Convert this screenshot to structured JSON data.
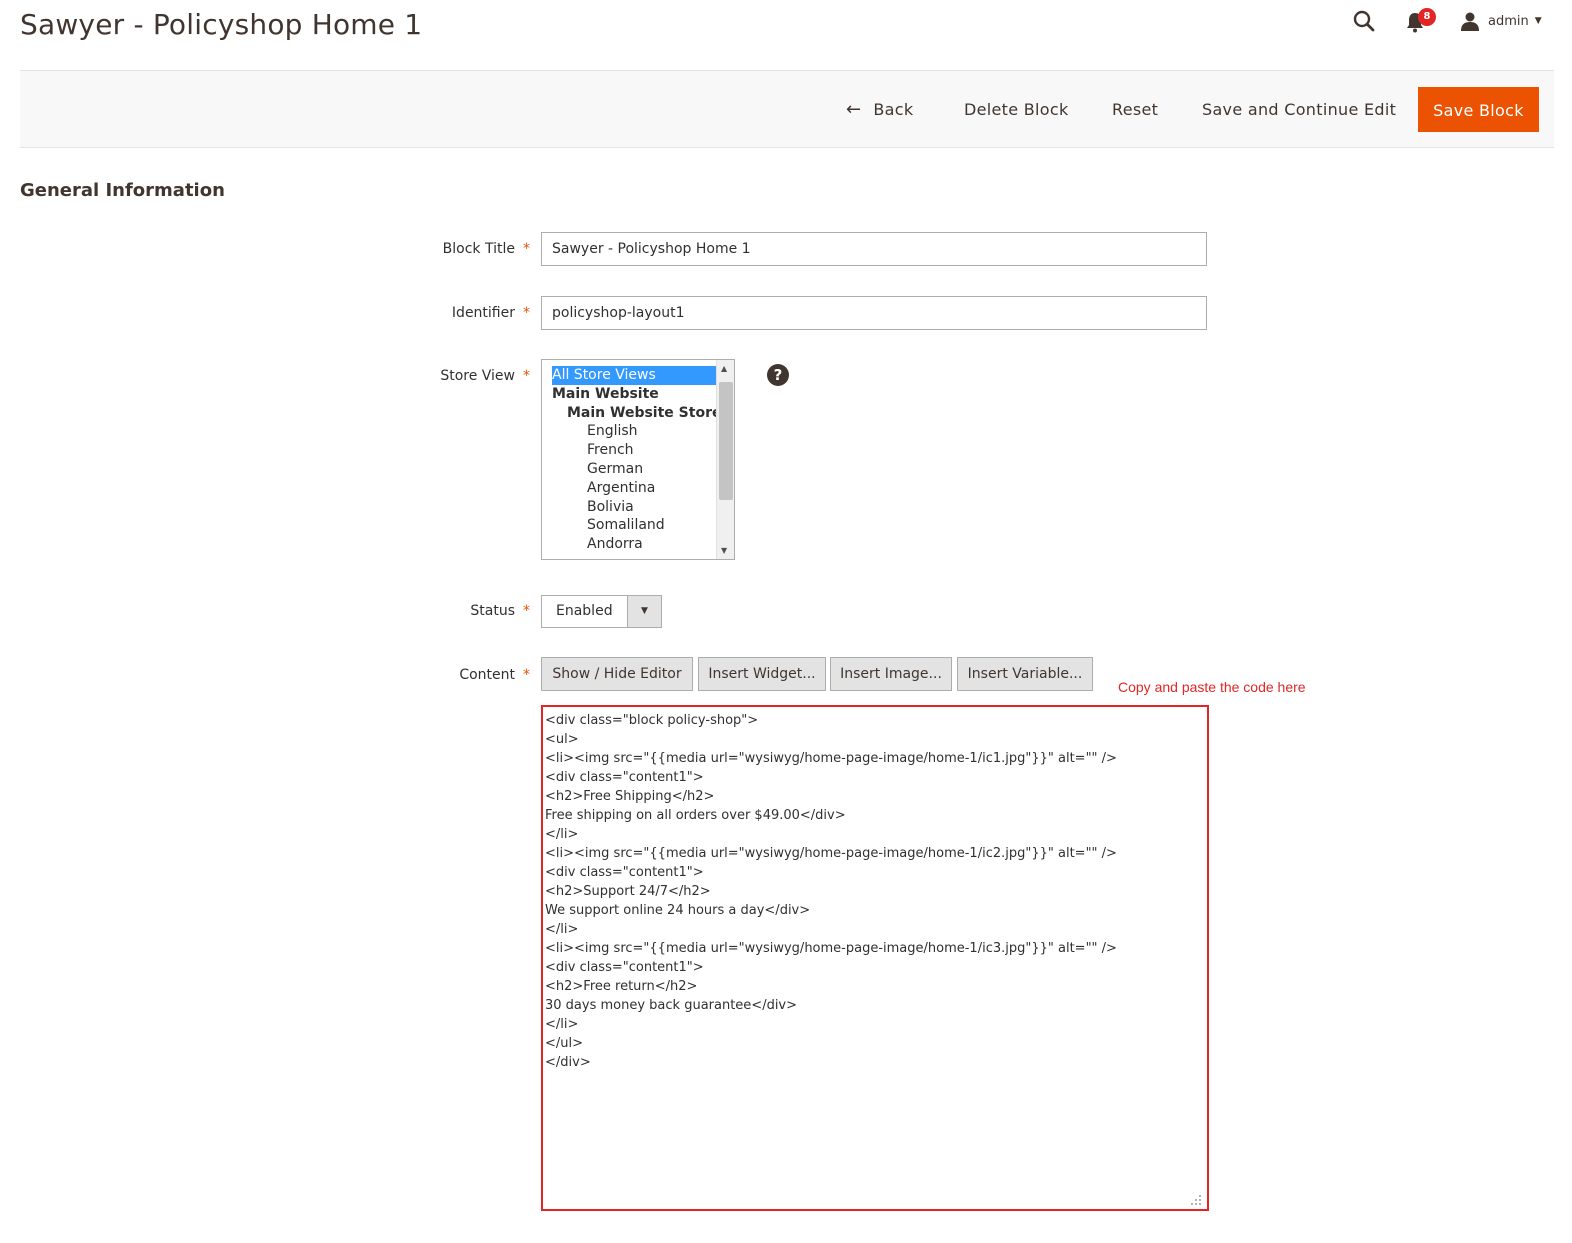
{
  "page": {
    "title": "Sawyer - Policyshop Home 1"
  },
  "header": {
    "notifications_count": "8",
    "user_name": "admin"
  },
  "toolbar": {
    "back_label": "Back",
    "delete_label": "Delete Block",
    "reset_label": "Reset",
    "save_continue_label": "Save and Continue Edit",
    "save_label": "Save Block"
  },
  "section": {
    "title": "General Information"
  },
  "form": {
    "block_title": {
      "label": "Block Title",
      "value": "Sawyer - Policyshop Home 1"
    },
    "identifier": {
      "label": "Identifier",
      "value": "policyshop-layout1"
    },
    "store_view": {
      "label": "Store View",
      "options": [
        {
          "label": "All Store Views",
          "kind": "selected"
        },
        {
          "label": "Main Website",
          "kind": "group"
        },
        {
          "label": "Main Website Store",
          "kind": "group2"
        },
        {
          "label": "English",
          "kind": "leaf"
        },
        {
          "label": "French",
          "kind": "leaf"
        },
        {
          "label": "German",
          "kind": "leaf"
        },
        {
          "label": "Argentina",
          "kind": "leaf"
        },
        {
          "label": "Bolivia",
          "kind": "leaf"
        },
        {
          "label": "Somaliland",
          "kind": "leaf"
        },
        {
          "label": "Andorra",
          "kind": "leaf"
        }
      ]
    },
    "status": {
      "label": "Status",
      "value": "Enabled"
    },
    "content": {
      "label": "Content",
      "buttons": {
        "show_hide": "Show / Hide Editor",
        "insert_widget": "Insert Widget...",
        "insert_image": "Insert Image...",
        "insert_variable": "Insert Variable..."
      },
      "hint": "Copy and paste the code here",
      "value": "<div class=\"block policy-shop\">\n<ul>\n<li><img src=\"{{media url=\"wysiwyg/home-page-image/home-1/ic1.jpg\"}}\" alt=\"\" />\n<div class=\"content1\">\n<h2>Free Shipping</h2>\nFree shipping on all orders over $49.00</div>\n</li>\n<li><img src=\"{{media url=\"wysiwyg/home-page-image/home-1/ic2.jpg\"}}\" alt=\"\" />\n<div class=\"content1\">\n<h2>Support 24/7</h2>\nWe support online 24 hours a day</div>\n</li>\n<li><img src=\"{{media url=\"wysiwyg/home-page-image/home-1/ic3.jpg\"}}\" alt=\"\" />\n<div class=\"content1\">\n<h2>Free return</h2>\n30 days money back guarantee</div>\n</li>\n</ul>\n</div>"
    }
  }
}
